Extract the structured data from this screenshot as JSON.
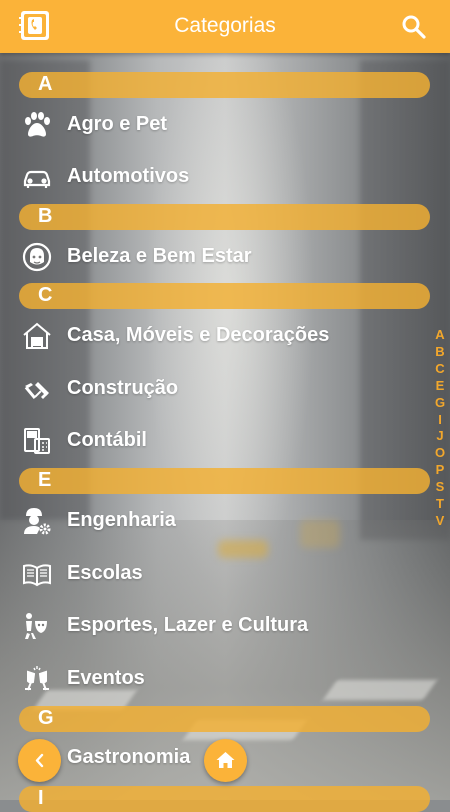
{
  "appbar": {
    "title": "Categorias",
    "logo_icon": "phone-book-icon",
    "search_icon": "search-icon"
  },
  "sections": [
    {
      "letter": "A",
      "items": [
        {
          "label": "Agro e Pet",
          "icon": "paw-icon"
        },
        {
          "label": "Automotivos",
          "icon": "car-icon"
        }
      ]
    },
    {
      "letter": "B",
      "items": [
        {
          "label": "Beleza e Bem Estar",
          "icon": "beauty-face-icon"
        }
      ]
    },
    {
      "letter": "C",
      "items": [
        {
          "label": "Casa, Móveis e Decorações",
          "icon": "house-icon"
        },
        {
          "label": "Construção",
          "icon": "tools-icon"
        },
        {
          "label": "Contábil",
          "icon": "calculator-icon"
        }
      ]
    },
    {
      "letter": "E",
      "items": [
        {
          "label": "Engenharia",
          "icon": "engineer-icon"
        },
        {
          "label": "Escolas",
          "icon": "book-icon"
        },
        {
          "label": "Esportes, Lazer e Cultura",
          "icon": "theater-masks-icon"
        },
        {
          "label": "Eventos",
          "icon": "champagne-icon"
        }
      ]
    },
    {
      "letter": "G",
      "items": [
        {
          "label": "Gastronomia",
          "icon": "food-icon"
        }
      ]
    },
    {
      "letter": "I",
      "items": []
    }
  ],
  "alphabet_index": [
    "A",
    "B",
    "C",
    "E",
    "G",
    "I",
    "J",
    "O",
    "P",
    "S",
    "T",
    "V"
  ],
  "fab": {
    "back_icon": "chevron-left-icon",
    "home_icon": "home-icon"
  },
  "colors": {
    "accent": "#fbb339",
    "section_bar": "#f3b032",
    "index_text": "#f2a72c"
  }
}
